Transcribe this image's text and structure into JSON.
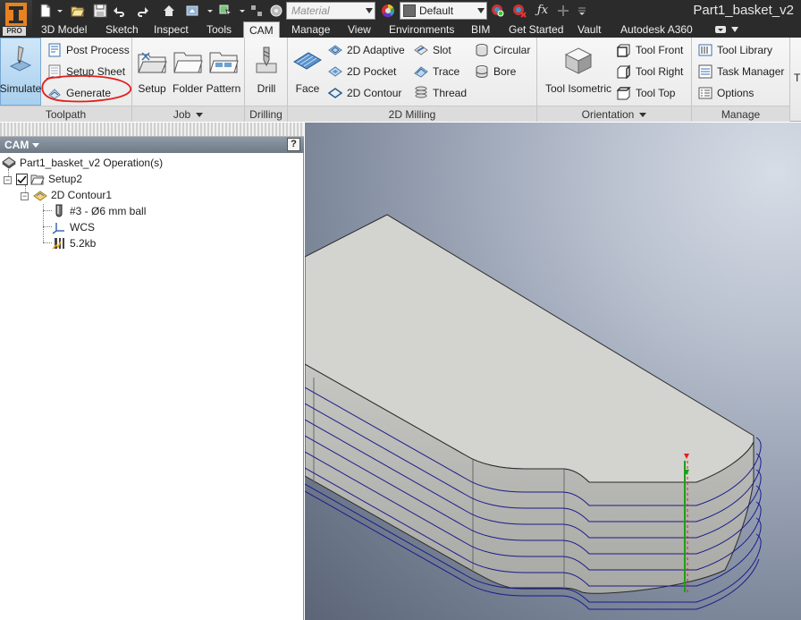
{
  "app": {
    "edition_badge": "PRO",
    "document_title": "Part1_basket_v2"
  },
  "quick_access": {
    "material": {
      "value": "",
      "placeholder": "Material"
    },
    "appearance": {
      "value": "Default"
    },
    "icons": [
      "new-icon",
      "open-icon",
      "save-icon",
      "undo-icon",
      "redo-icon",
      "home-icon",
      "update-icon",
      "select-icon",
      "measure-icon",
      "color-wheel-icon",
      "sphere-icon",
      "appearance-pick-icon",
      "appearance-clear-icon",
      "fx-icon",
      "add-icon",
      "customize-icon"
    ]
  },
  "tabs": [
    {
      "label": "3D Model"
    },
    {
      "label": "Sketch"
    },
    {
      "label": "Inspect"
    },
    {
      "label": "Tools"
    },
    {
      "label": "CAM",
      "active": true
    },
    {
      "label": "Manage"
    },
    {
      "label": "View"
    },
    {
      "label": "Environments"
    },
    {
      "label": "BIM"
    },
    {
      "label": "Get Started"
    },
    {
      "label": "Vault"
    },
    {
      "label": "Autodesk A360"
    }
  ],
  "ribbon": {
    "toolpath": {
      "label": "Toolpath",
      "simulate": "Simulate",
      "post_process": "Post Process",
      "setup_sheet": "Setup Sheet",
      "generate": "Generate"
    },
    "job": {
      "label": "Job",
      "setup": "Setup",
      "folder": "Folder",
      "pattern": "Pattern"
    },
    "drilling": {
      "label": "Drilling",
      "drill": "Drill"
    },
    "milling_2d": {
      "label": "2D Milling",
      "face": "Face",
      "adaptive": "2D Adaptive",
      "pocket": "2D Pocket",
      "contour": "2D Contour",
      "slot": "Slot",
      "trace": "Trace",
      "thread": "Thread",
      "circular": "Circular",
      "bore": "Bore"
    },
    "orientation": {
      "label": "Orientation",
      "tool_isometric": "Tool Isometric",
      "tool_front": "Tool Front",
      "tool_right": "Tool Right",
      "tool_top": "Tool Top"
    },
    "manage": {
      "label": "Manage",
      "tool_library": "Tool Library",
      "task_manager": "Task Manager",
      "options": "Options"
    },
    "overflow_letter": "T"
  },
  "browser": {
    "title": "CAM",
    "help": "?",
    "tree": {
      "root": "Part1_basket_v2 Operation(s)",
      "setup": "Setup2",
      "operation": "2D Contour1",
      "tool": "#3 - Ø6 mm ball",
      "wcs": "WCS",
      "nc_size": "5.2kb"
    }
  },
  "colors": {
    "active_tab_bg": "#f3f3f3",
    "dark_chrome": "#2b2b2b",
    "annotation_red": "#e0201e",
    "toolpath_blue": "#1a1a8c"
  }
}
